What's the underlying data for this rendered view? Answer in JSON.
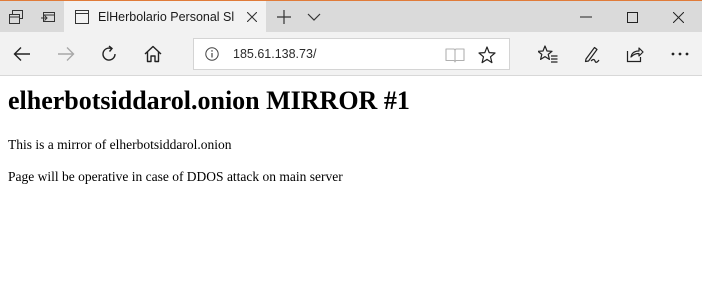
{
  "browser": {
    "tab": {
      "title": "ElHerbolario Personal Sl"
    },
    "address_bar": {
      "url": "185.61.138.73/"
    }
  },
  "page": {
    "heading": "elherbotsiddarol.onion MIRROR #1",
    "paragraphs": [
      "This is a mirror of elherbotsiddarol.onion",
      "Page will be operative in case of DDOS attack on main server"
    ]
  }
}
